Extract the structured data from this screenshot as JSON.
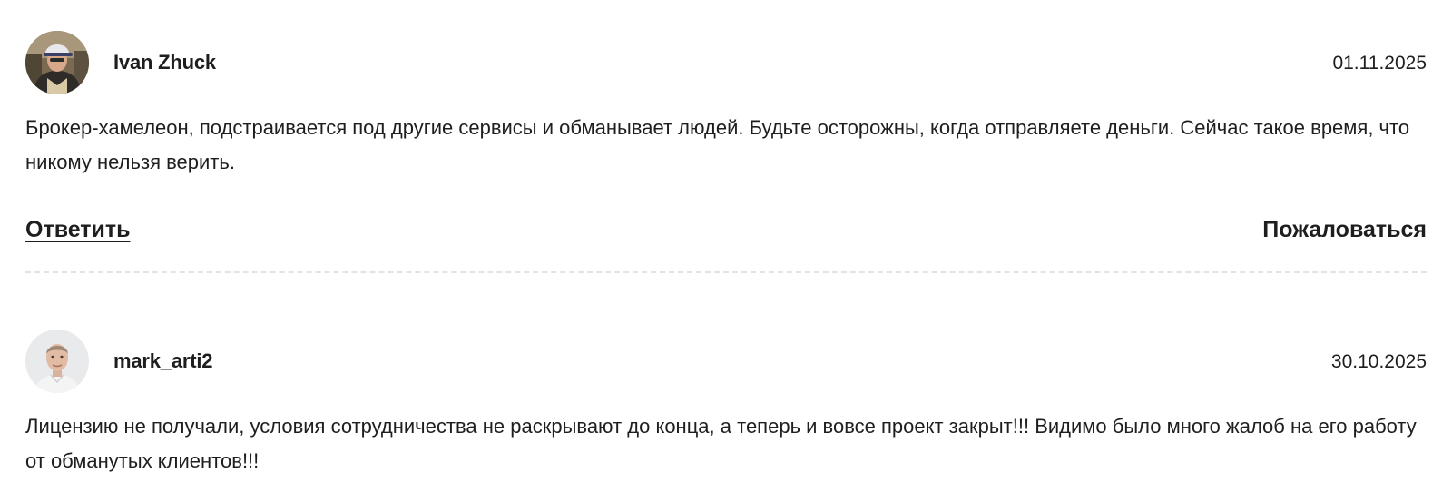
{
  "reviews": [
    {
      "author": "Ivan Zhuck",
      "date": "01.11.2025",
      "text": "Брокер-хамелеон, подстраивается под другие сервисы и обманывает людей. Будьте осторожны, когда отправляете деньги. Сейчас такое время, что никому нельзя верить.",
      "reply_label": "Ответить",
      "report_label": "Пожаловаться",
      "avatar_icon": "user-photo-cap"
    },
    {
      "author": "mark_arti2",
      "date": "30.10.2025",
      "text": "Лицензию не получали, условия сотрудничества не раскрывают до конца, а теперь и вовсе проект закрыт!!! Видимо было много жалоб на его работу от обманутых клиентов!!!",
      "avatar_icon": "user-photo-bald"
    }
  ],
  "colors": {
    "text": "#1e1e1e",
    "divider": "#e3e3e3"
  }
}
